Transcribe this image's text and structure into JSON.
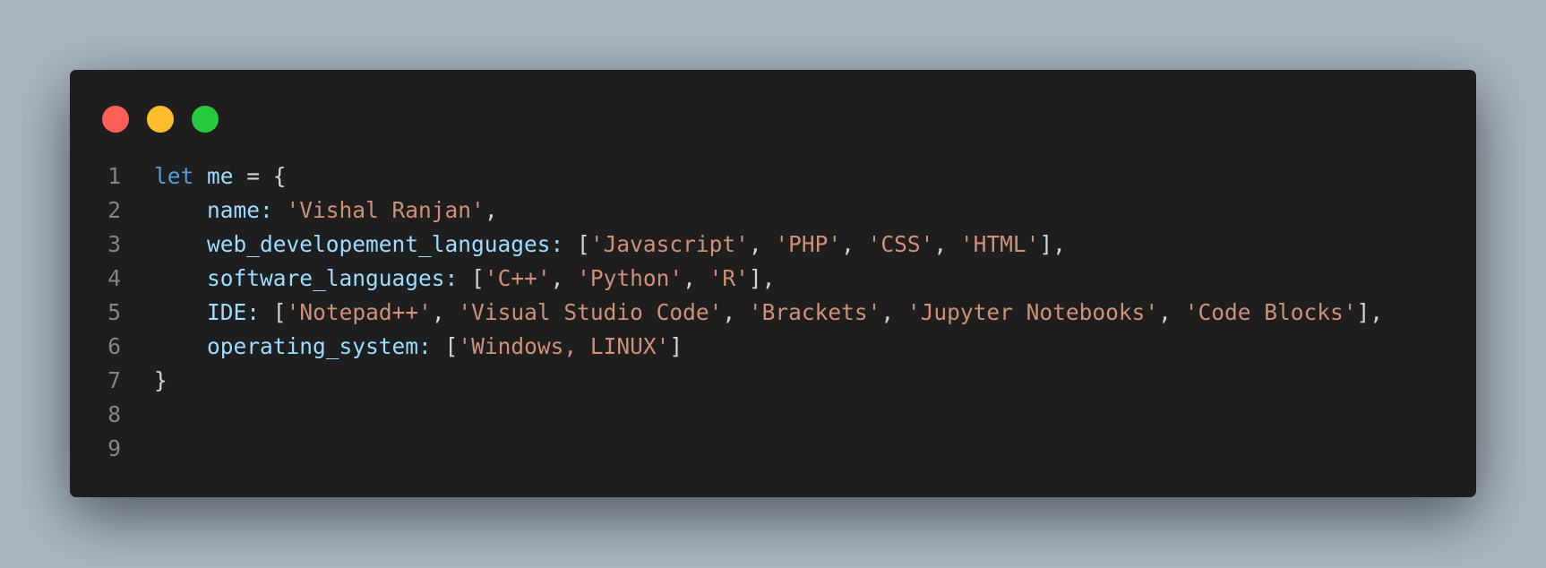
{
  "window": {
    "controls": [
      {
        "name": "close",
        "color": "#ff5f56"
      },
      {
        "name": "minimize",
        "color": "#ffbd2e"
      },
      {
        "name": "maximize",
        "color": "#27c93f"
      }
    ]
  },
  "code": {
    "lines": [
      {
        "number": "1",
        "kw": "let",
        "var": "me",
        "op": " = {"
      },
      {
        "number": "2",
        "key": "name:",
        "str": "'Vishal Ranjan'",
        "end": ","
      },
      {
        "number": "3",
        "key": "web_developement_languages:",
        "items": [
          "'Javascript'",
          "'PHP'",
          "'CSS'",
          "'HTML'"
        ],
        "end": "],"
      },
      {
        "number": "4",
        "key": "software_languages:",
        "items": [
          "'C++'",
          "'Python'",
          "'R'"
        ],
        "end": "],"
      },
      {
        "number": "5",
        "key": "IDE:",
        "items": [
          "'Notepad++'",
          "'Visual Studio Code'",
          "'Brackets'",
          "'Jupyter Notebooks'",
          "'Code Blocks'"
        ],
        "end": "],"
      },
      {
        "number": "6",
        "key": "operating_system:",
        "items": [
          "'Windows, LINUX'"
        ],
        "end": "]"
      },
      {
        "number": "7",
        "close": "}"
      },
      {
        "number": "8"
      },
      {
        "number": "9"
      }
    ]
  }
}
